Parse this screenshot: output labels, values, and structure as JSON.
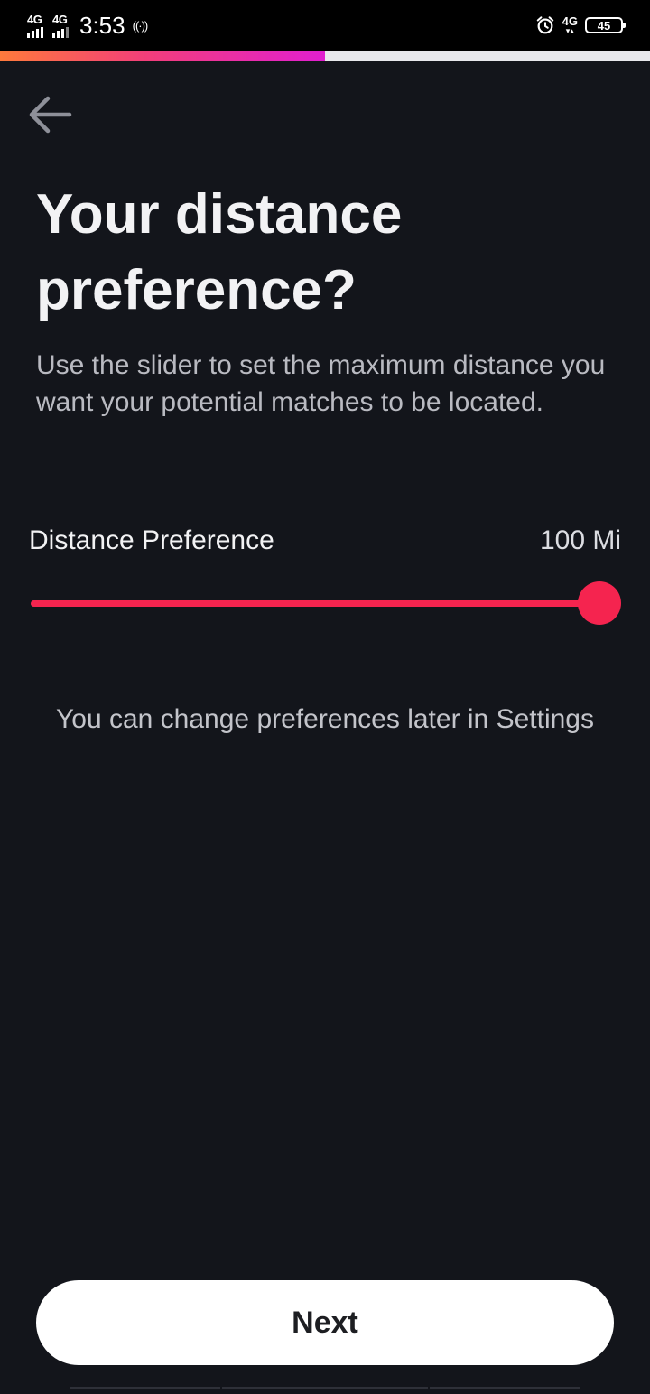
{
  "status_bar": {
    "network_1": "4G",
    "network_2": "4G",
    "time": "3:53",
    "hotspot_glyph": "((·))",
    "right_network": "4G",
    "right_network_arrows": "▾▴",
    "battery_level": "45",
    "icons": [
      "signal-icon",
      "signal-icon",
      "hotspot-icon",
      "alarm-icon",
      "battery-icon"
    ]
  },
  "progress": {
    "fraction": 0.5,
    "colors": [
      "#ff7a3c",
      "#f23e7a",
      "#e11fd0"
    ]
  },
  "header": {
    "back_icon": "arrow-left-icon",
    "title": "Your distance preference?",
    "subtitle": "Use the slider to set the maximum distance you want your potential matches to be located."
  },
  "slider": {
    "label": "Distance Preference",
    "value_text": "100 Mi",
    "value": 100,
    "max": 100,
    "accent_color": "#f5244f"
  },
  "note": "You can change preferences later in Settings",
  "footer": {
    "next_label": "Next"
  },
  "colors": {
    "background": "#13151b",
    "accent": "#f5244f",
    "button_bg": "#ffffff"
  }
}
